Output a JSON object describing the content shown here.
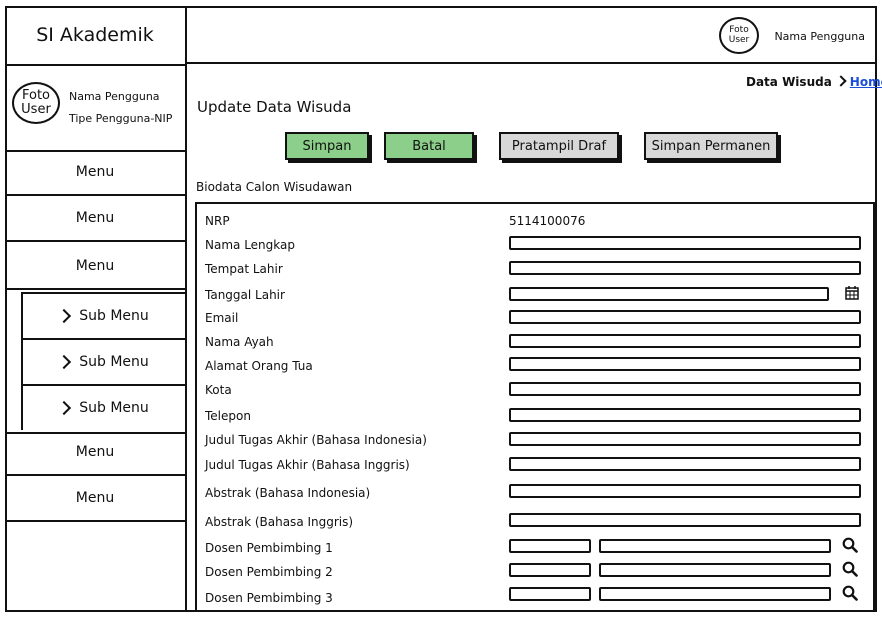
{
  "app": {
    "title": "SI Akademik"
  },
  "user": {
    "photo_line1": "Foto",
    "photo_line2": "User",
    "name": "Nama Pengguna",
    "type": "Tipe Pengguna-NIP"
  },
  "sidebar": {
    "menus_top": [
      "Menu",
      "Menu",
      "Menu"
    ],
    "submenus": [
      "Sub Menu",
      "Sub Menu",
      "Sub Menu"
    ],
    "menus_bottom": [
      "Menu",
      "Menu"
    ]
  },
  "breadcrumb": {
    "current": "Data Wisuda",
    "home": "Home"
  },
  "page": {
    "title": "Update Data Wisuda"
  },
  "buttons": {
    "simpan": "Simpan",
    "batal": "Batal",
    "pratampil": "Pratampil Draf",
    "permanen": "Simpan Permanen"
  },
  "section": {
    "title": "Biodata Calon Wisudawan"
  },
  "form": {
    "nrp_label": "NRP",
    "nrp_value": "5114100076",
    "fields": [
      "Nama Lengkap",
      "Tempat Lahir",
      "Tanggal Lahir",
      "Email",
      "Nama Ayah",
      "Alamat Orang Tua",
      "Kota",
      "Telepon",
      "Judul Tugas Akhir (Bahasa Indonesia)",
      "Judul Tugas Akhir (Bahasa Inggris)",
      "Abstrak (Bahasa Indonesia)",
      "Abstrak (Bahasa Inggris)",
      "Dosen Pembimbing 1",
      "Dosen Pembimbing 2",
      "Dosen Pembimbing 3"
    ]
  },
  "icons": {
    "calendar": "calendar-icon",
    "search": "search-icon"
  }
}
